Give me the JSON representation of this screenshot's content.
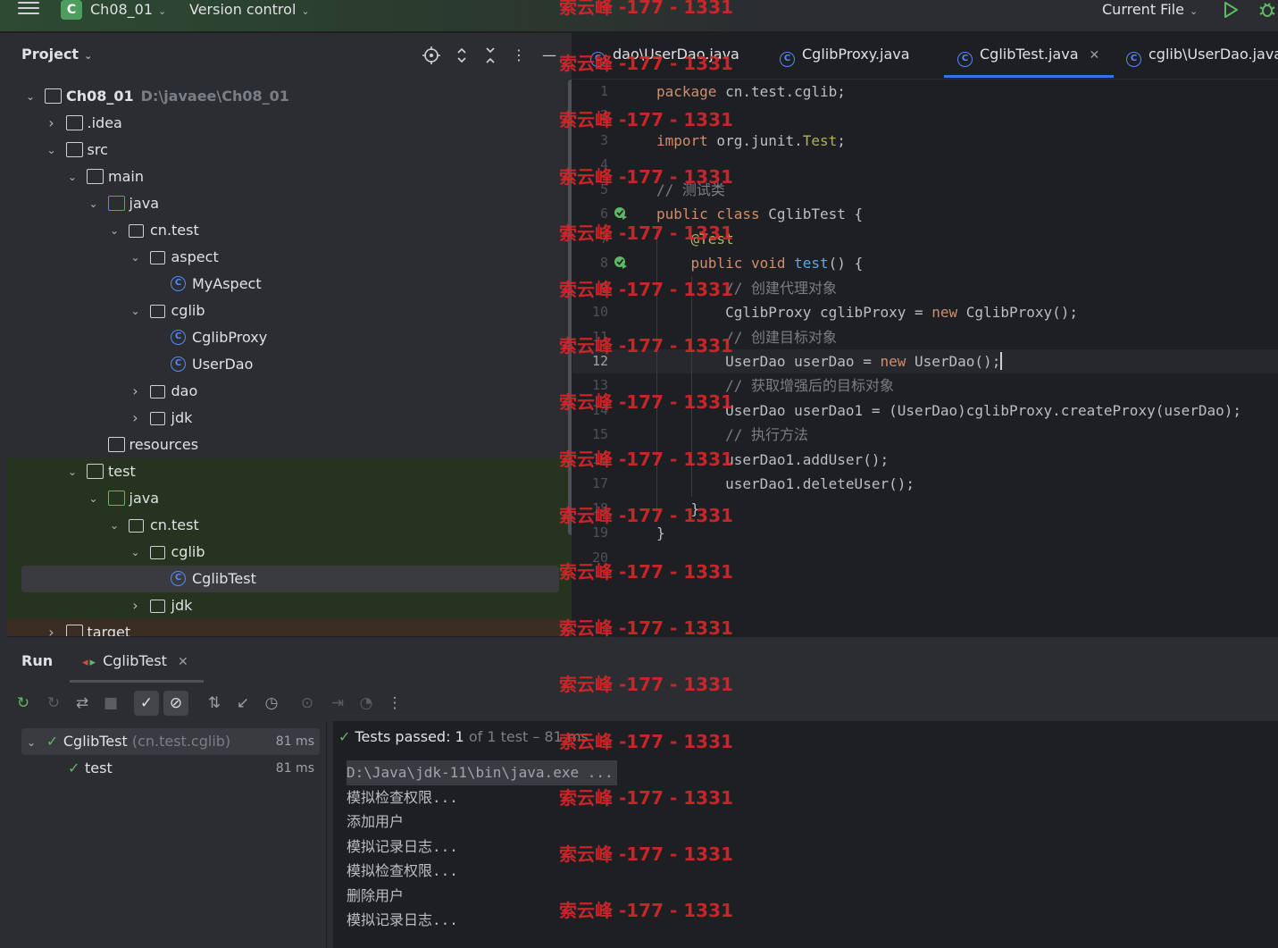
{
  "titlebar": {
    "project_badge": "C",
    "project_name": "Ch08_01",
    "version_control": "Version control",
    "run_config": "Current File"
  },
  "project": {
    "title": "Project",
    "tree": [
      {
        "label": "Ch08_01",
        "path": "D:\\javaee\\Ch08_01",
        "icon": "module-folder-icon",
        "depth": 0,
        "expanded": true
      },
      {
        "label": ".idea",
        "icon": "folder-icon",
        "depth": 1,
        "expanded": false
      },
      {
        "label": "src",
        "icon": "folder-icon",
        "depth": 1,
        "expanded": true
      },
      {
        "label": "main",
        "icon": "folder-icon",
        "depth": 2,
        "expanded": true
      },
      {
        "label": "java",
        "icon": "source-folder-icon",
        "depth": 3,
        "expanded": true
      },
      {
        "label": "cn.test",
        "icon": "package-icon",
        "depth": 4,
        "expanded": true
      },
      {
        "label": "aspect",
        "icon": "package-icon",
        "depth": 5,
        "expanded": true
      },
      {
        "label": "MyAspect",
        "icon": "class-icon",
        "depth": 6
      },
      {
        "label": "cglib",
        "icon": "package-icon",
        "depth": 5,
        "expanded": true
      },
      {
        "label": "CglibProxy",
        "icon": "class-icon",
        "depth": 6
      },
      {
        "label": "UserDao",
        "icon": "class-icon",
        "depth": 6
      },
      {
        "label": "dao",
        "icon": "package-icon",
        "depth": 5,
        "expanded": false
      },
      {
        "label": "jdk",
        "icon": "package-icon",
        "depth": 5,
        "expanded": false
      },
      {
        "label": "resources",
        "icon": "resources-folder-icon",
        "depth": 3
      },
      {
        "label": "test",
        "icon": "folder-icon",
        "depth": 2,
        "expanded": true
      },
      {
        "label": "java",
        "icon": "test-source-folder-icon",
        "depth": 3,
        "expanded": true
      },
      {
        "label": "cn.test",
        "icon": "package-icon",
        "depth": 4,
        "expanded": true
      },
      {
        "label": "cglib",
        "icon": "package-icon",
        "depth": 5,
        "expanded": true
      },
      {
        "label": "CglibTest",
        "icon": "class-icon",
        "depth": 6,
        "selected": true
      },
      {
        "label": "jdk",
        "icon": "package-icon",
        "depth": 5,
        "expanded": false
      },
      {
        "label": "target",
        "icon": "folder-icon",
        "depth": 1,
        "expanded": false
      }
    ]
  },
  "editor": {
    "tabs": [
      {
        "label": "dao\\UserDao.java"
      },
      {
        "label": "CglibProxy.java"
      },
      {
        "label": "CglibTest.java",
        "active": true
      },
      {
        "label": "cglib\\UserDao.java"
      }
    ],
    "lines": [
      {
        "n": "1",
        "html": "<span class='kw'>package</span> cn.test.cglib;"
      },
      {
        "n": "2",
        "html": ""
      },
      {
        "n": "3",
        "html": "<span class='kw'>import</span> org.junit.<span class='ann'>Test</span>;"
      },
      {
        "n": "4",
        "html": ""
      },
      {
        "n": "5",
        "html": "<span class='cm'>// 测试类</span>"
      },
      {
        "n": "6",
        "html": "<span class='kw'>public class</span> CglibTest {"
      },
      {
        "n": "7",
        "html": "    <span class='ann'>@Test</span>"
      },
      {
        "n": "8",
        "html": "    <span class='kw'>public void</span> <span class='fn'>test</span>() {"
      },
      {
        "n": "9",
        "html": "        <span class='cm'>// 创建代理对象</span>"
      },
      {
        "n": "10",
        "html": "        CglibProxy cglibProxy = <span class='kw'>new</span> CglibProxy();"
      },
      {
        "n": "11",
        "html": "        <span class='cm'>// 创建目标对象</span>"
      },
      {
        "n": "12",
        "html": "        UserDao userDao = <span class='kw'>new</span> UserDao();<span class='caret'></span>"
      },
      {
        "n": "13",
        "html": "        <span class='cm'>// 获取增强后的目标对象</span>"
      },
      {
        "n": "14",
        "html": "        UserDao userDao1 = (UserDao)cglibProxy.createProxy(userDao);"
      },
      {
        "n": "15",
        "html": "        <span class='cm'>// 执行方法</span>"
      },
      {
        "n": "16",
        "html": "        userDao1.addUser();"
      },
      {
        "n": "17",
        "html": "        userDao1.deleteUser();"
      },
      {
        "n": "18",
        "html": "    }"
      },
      {
        "n": "19",
        "html": "}"
      },
      {
        "n": "20",
        "html": ""
      }
    ]
  },
  "run": {
    "title": "Run",
    "tab_label": "CglibTest",
    "tests": [
      {
        "name": "CglibTest",
        "pkg": "(cn.test.cglib)",
        "duration": "81 ms"
      },
      {
        "name": "test",
        "duration": "81 ms"
      }
    ],
    "status": {
      "prefix": "Tests passed:",
      "count": "1",
      "suffix": "of 1 test – 81 ms"
    },
    "console": [
      "D:\\Java\\jdk-11\\bin\\java.exe ...",
      "模拟检查权限...",
      "添加用户",
      "模拟记录日志...",
      "模拟检查权限...",
      "删除用户",
      "模拟记录日志..."
    ]
  },
  "watermark": "索云峰 -177 - 1331",
  "colors": {
    "accent": "#3574f0",
    "success": "#5fb865",
    "watermark": "#d9262b",
    "keyword": "#cf8e6d",
    "function": "#56a8f5",
    "annotation": "#b3ae60"
  }
}
